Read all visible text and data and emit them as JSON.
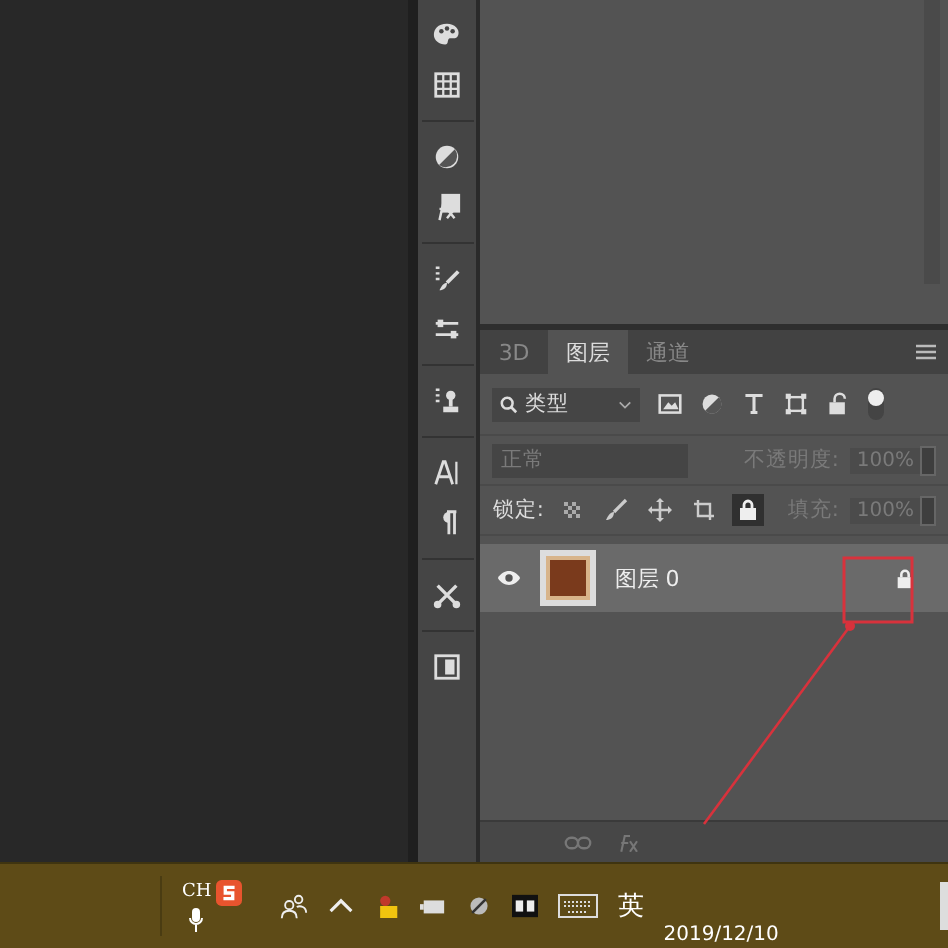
{
  "tabs": [
    {
      "label": "3D",
      "selected": false
    },
    {
      "label": "图层",
      "selected": true
    },
    {
      "label": "通道",
      "selected": false
    }
  ],
  "filter": {
    "value": "类型"
  },
  "blend_mode": {
    "value": "正常",
    "disabled": true
  },
  "opacity": {
    "label": "不透明度:",
    "value": "100%",
    "disabled": true
  },
  "lock": {
    "label": "锁定:",
    "options": [
      {
        "kind": "pixels",
        "selected": false
      },
      {
        "kind": "paint",
        "selected": false
      },
      {
        "kind": "move",
        "selected": false
      },
      {
        "kind": "artboard",
        "selected": false
      },
      {
        "kind": "all",
        "selected": true
      }
    ]
  },
  "fill": {
    "label": "填充:",
    "value": "100%",
    "disabled": true
  },
  "layers": [
    {
      "name": "图层 0",
      "visible": true,
      "selected": true,
      "locked": true
    }
  ],
  "taskbar": {
    "input_method": "CH",
    "language": "英",
    "clock": "2019/12/10"
  }
}
